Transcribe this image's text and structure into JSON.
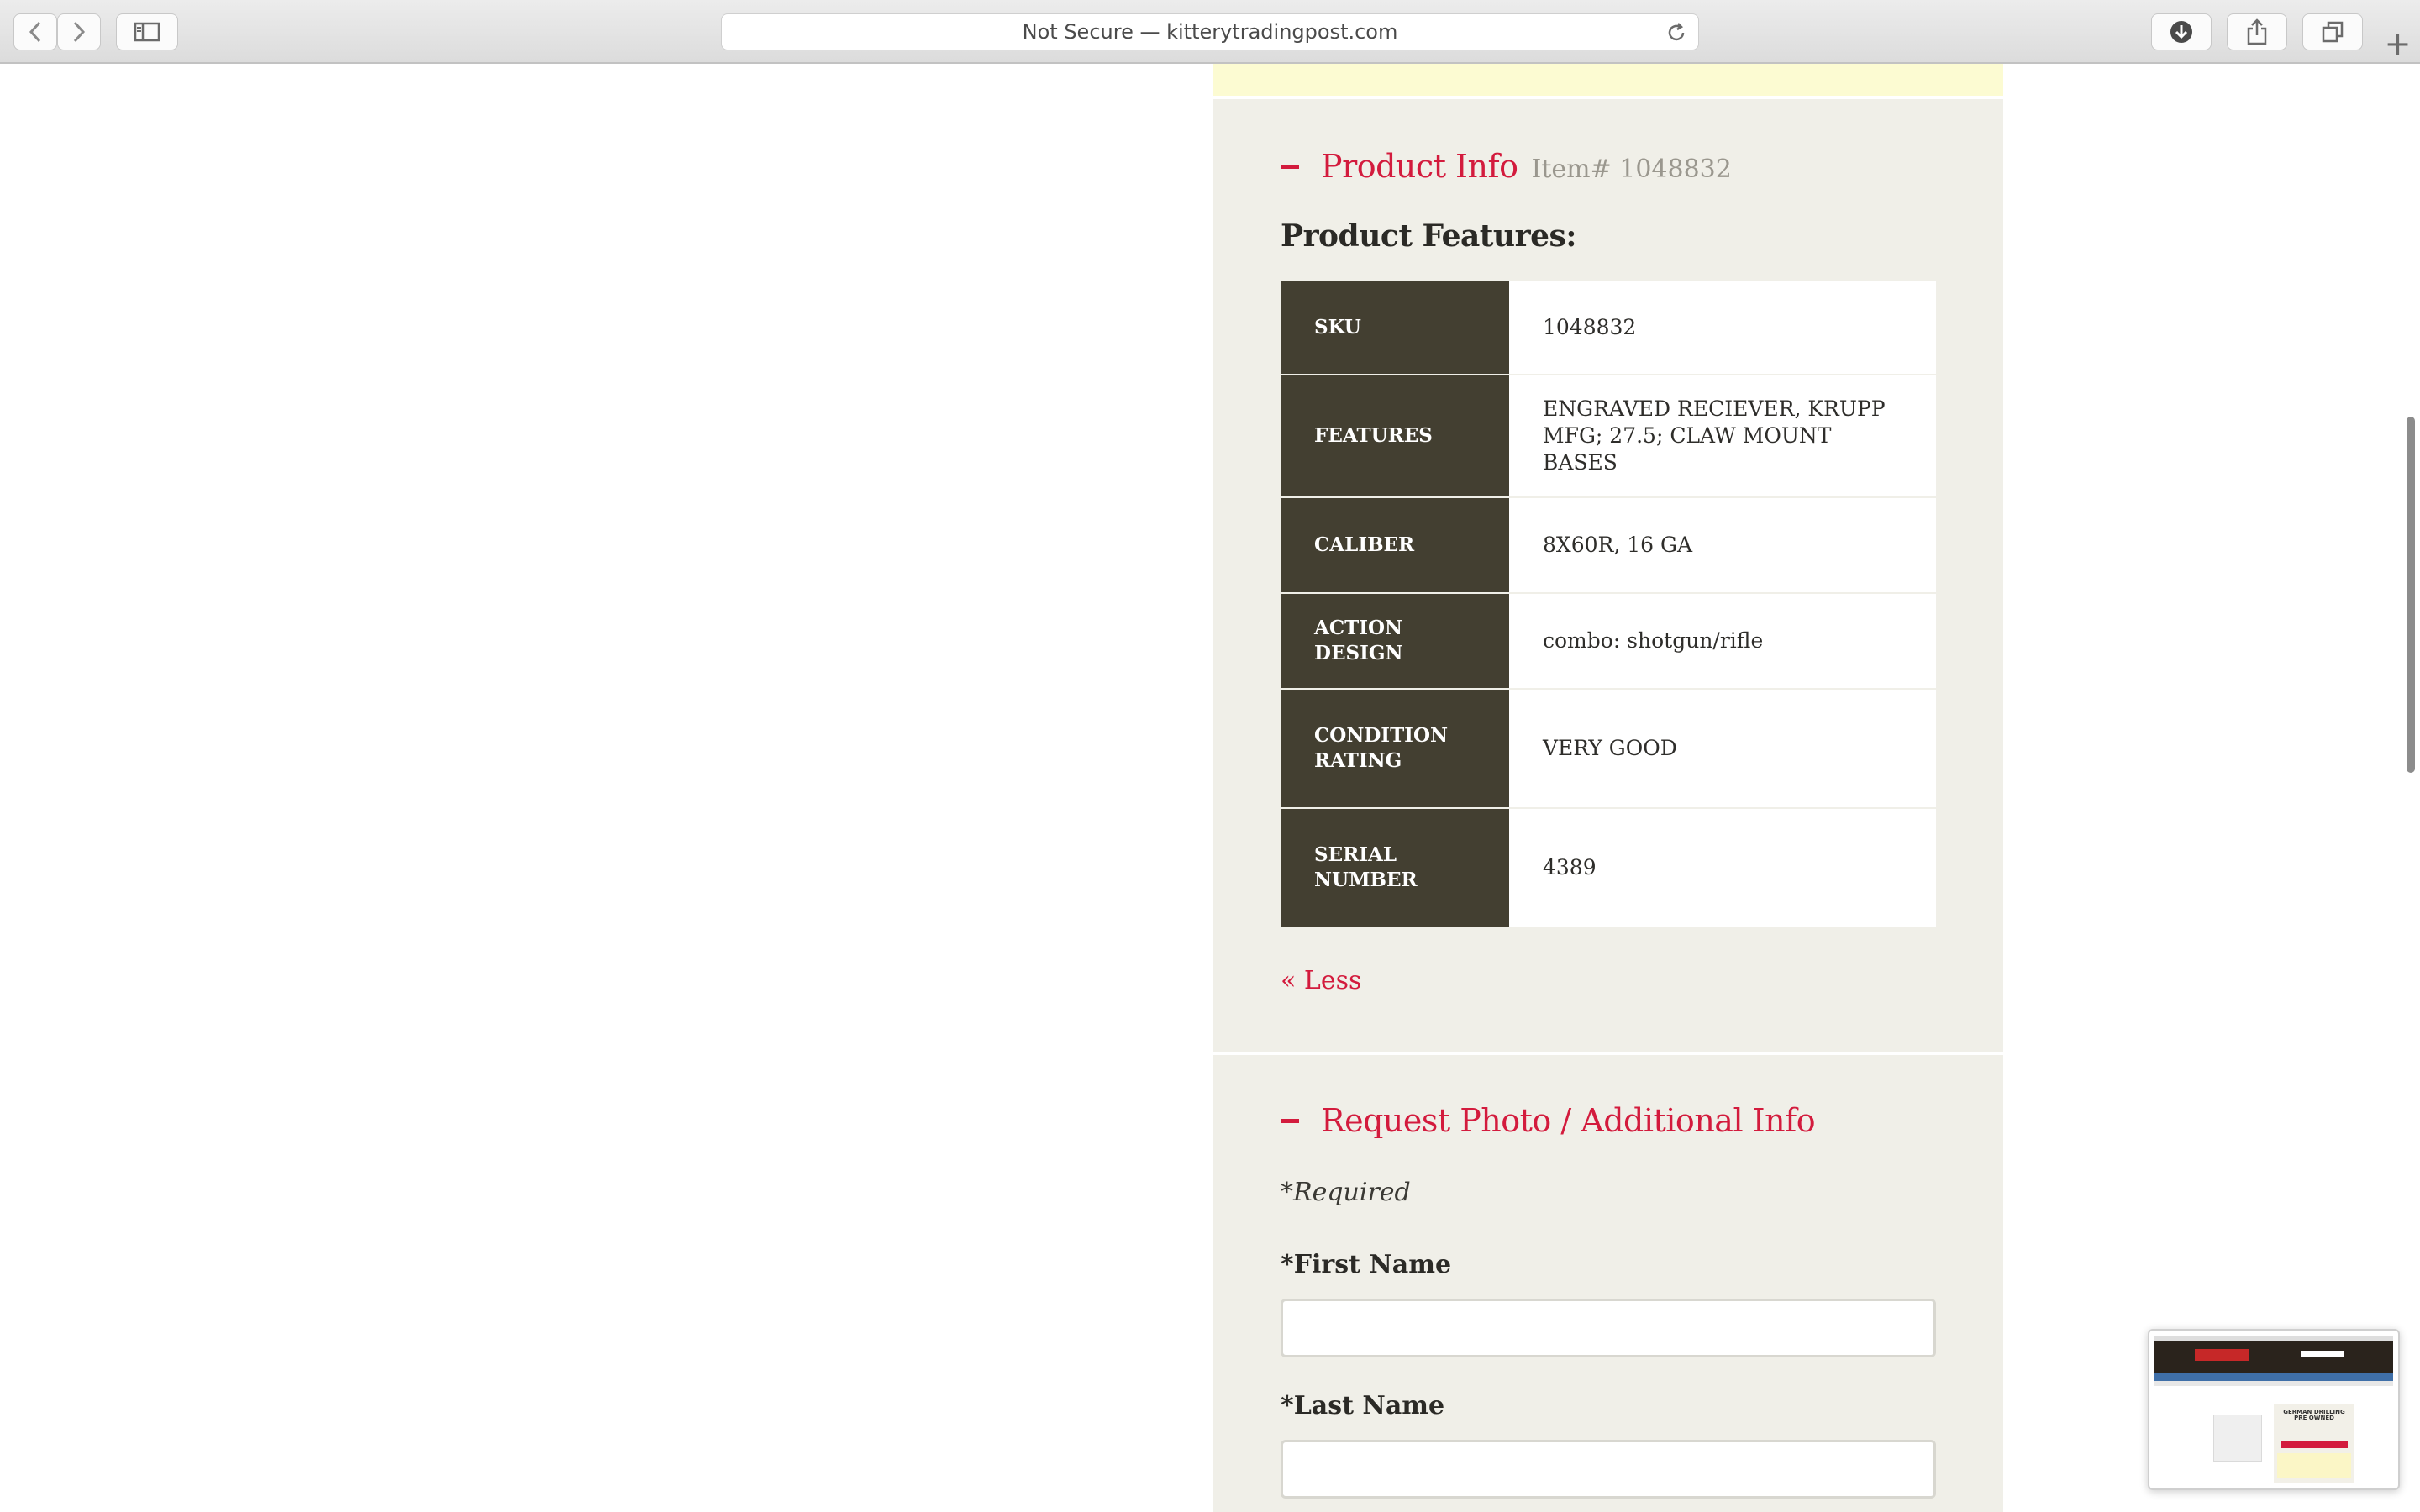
{
  "browser": {
    "address": "Not Secure — kitterytradingpost.com"
  },
  "product_info": {
    "title": "Product Info",
    "item_number": "Item# 1048832",
    "features_title": "Product Features:",
    "rows": [
      {
        "key": "SKU",
        "value": "1048832"
      },
      {
        "key": "FEATURES",
        "value": "ENGRAVED RECIEVER, KRUPP MFG; 27.5; CLAW MOUNT BASES"
      },
      {
        "key": "CALIBER",
        "value": "8X60R, 16 GA"
      },
      {
        "key": "ACTION DESIGN",
        "value": "combo: shotgun/rifle"
      },
      {
        "key": "CONDITION RATING",
        "value": "VERY GOOD"
      },
      {
        "key": "SERIAL NUMBER",
        "value": "4389"
      }
    ],
    "less_link": "« Less"
  },
  "request_form": {
    "title": "Request Photo / Additional Info",
    "required_note": "*Required",
    "first_name_label": "*First Name",
    "first_name_value": "",
    "last_name_label": "*Last Name",
    "last_name_value": ""
  },
  "thumbnail": {
    "title": "GERMAN DRILLING PRE OWNED"
  }
}
